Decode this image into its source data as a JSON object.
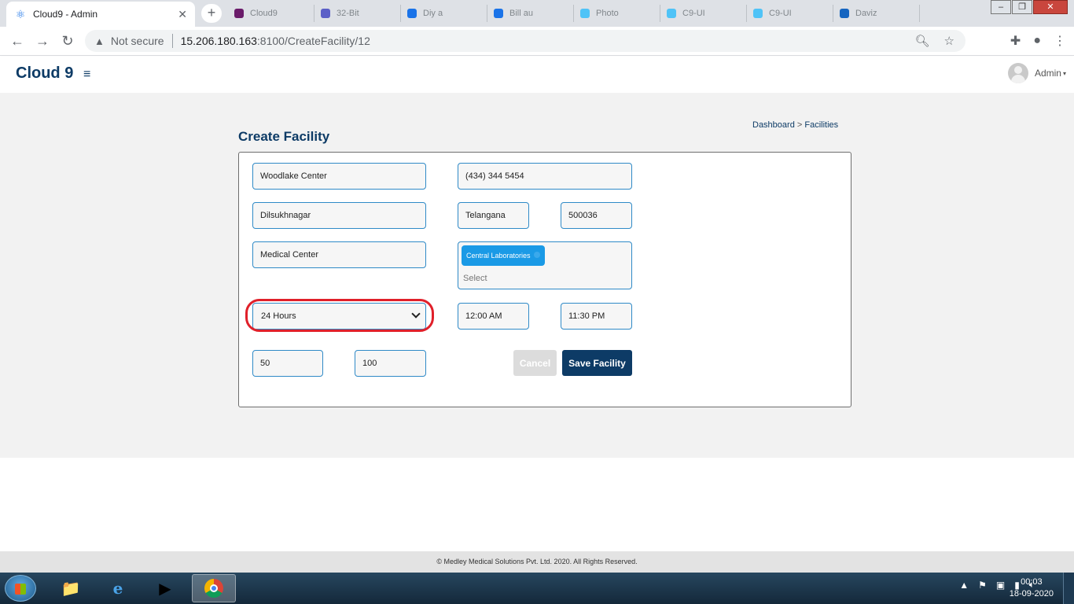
{
  "browser": {
    "active_tab_title": "Cloud9 - Admin",
    "background_tabs": [
      "Cloud9",
      "32-Bit",
      "Diy a",
      "Bill au",
      "Photo",
      "C9-UI",
      "C9-UI",
      "Daviz"
    ],
    "not_secure": "Not secure",
    "url_host": "15.206.180.163",
    "url_rest": ":8100/CreateFacility/12"
  },
  "app": {
    "brand": "Cloud 9",
    "hamburger": "≡",
    "user_name": "Admin",
    "user_caret": "▾"
  },
  "page": {
    "title": "Create Facility",
    "breadcrumb": {
      "dashboard": "Dashboard",
      "separator": " > ",
      "current": "Facilities"
    }
  },
  "form": {
    "facility_name": "Woodlake Center",
    "phone": "(434) 344 5454",
    "city": "Dilsukhnagar",
    "state": "Telangana",
    "zip": "500036",
    "facility_type": "Medical Center",
    "laboratory_chip": "Central Laboratories",
    "laboratory_placeholder": "Select",
    "hours": "24 Hours",
    "open_time": "12:00 AM",
    "close_time": "11:30 PM",
    "field_a": "50",
    "field_b": "100",
    "cancel_label": "Cancel",
    "save_label": "Save Facility"
  },
  "footer": {
    "copyright": "© Medley Medical Solutions Pvt. Ltd. 2020. All Rights Reserved."
  },
  "taskbar": {
    "time": "00:03",
    "date": "18-09-2020"
  },
  "colors": {
    "brand": "#0d3b66",
    "field_border": "#2f8ac7",
    "chip": "#1a9ae6",
    "highlight": "#e0202a"
  }
}
